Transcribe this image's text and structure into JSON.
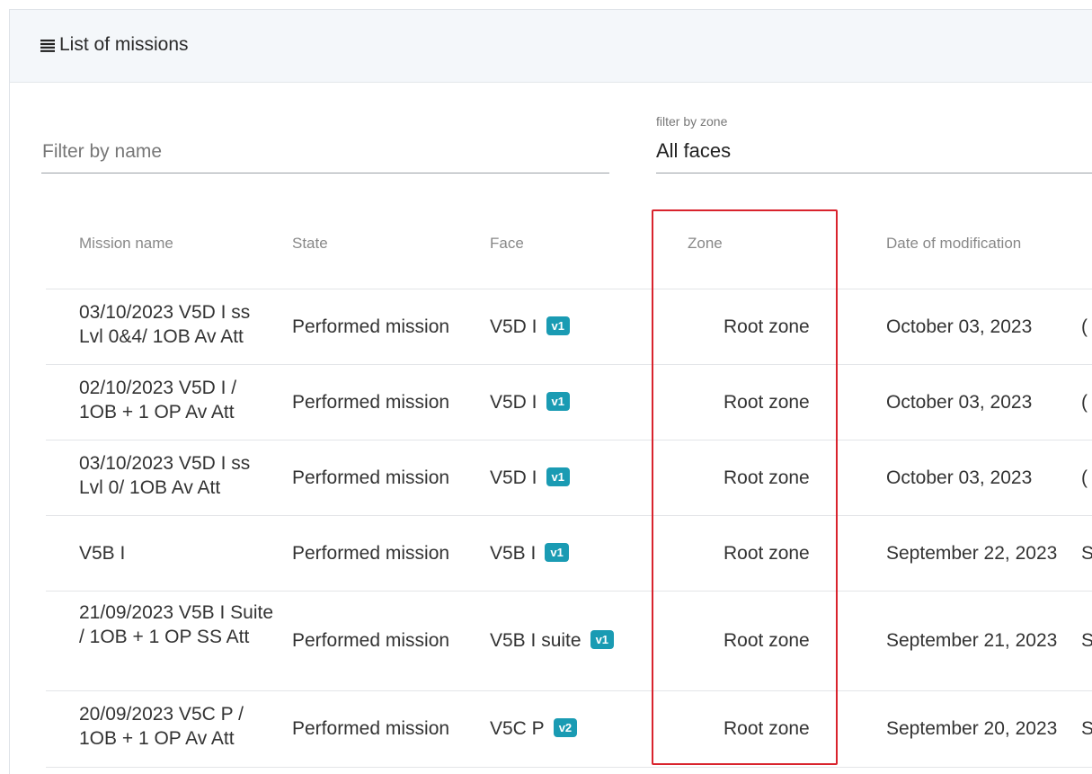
{
  "header": {
    "icon": "list-icon",
    "title": "List of missions"
  },
  "filters": {
    "name_placeholder": "Filter by name",
    "zone_label": "filter by zone",
    "zone_value": "All faces"
  },
  "table": {
    "columns": [
      "Mission name",
      "State",
      "Face",
      "Zone",
      "Date of modification"
    ],
    "rows": [
      {
        "name": "03/10/2023 V5D I ss Lvl 0&4/ 1OB Av Att",
        "state": "Performed mission",
        "face": "V5D I",
        "version": "v1",
        "zone": "Root zone",
        "date": "October 03, 2023",
        "extra": "("
      },
      {
        "name": "02/10/2023 V5D I / 1OB + 1 OP Av Att",
        "state": "Performed mission",
        "face": "V5D I",
        "version": "v1",
        "zone": "Root zone",
        "date": "October 03, 2023",
        "extra": "("
      },
      {
        "name": "03/10/2023 V5D I ss Lvl 0/ 1OB Av Att",
        "state": "Performed mission",
        "face": "V5D I",
        "version": "v1",
        "zone": "Root zone",
        "date": "October 03, 2023",
        "extra": "("
      },
      {
        "name": "V5B I",
        "state": "Performed mission",
        "face": "V5B I",
        "version": "v1",
        "zone": "Root zone",
        "date": "September 22, 2023",
        "extra": "S"
      },
      {
        "name": "21/09/2023 V5B I Suite / 1OB + 1 OP SS Att",
        "state": "Performed mission",
        "face": "V5B I suite",
        "version": "v1",
        "zone": "Root zone",
        "date": "September 21, 2023",
        "extra": "S"
      },
      {
        "name": "20/09/2023 V5C P / 1OB + 1 OP Av Att",
        "state": "Performed mission",
        "face": "V5C P",
        "version": "v2",
        "zone": "Root zone",
        "date": "September 20, 2023",
        "extra": "S"
      }
    ]
  },
  "colors": {
    "badge": "#1a9bb3",
    "highlight": "#d9232d"
  }
}
